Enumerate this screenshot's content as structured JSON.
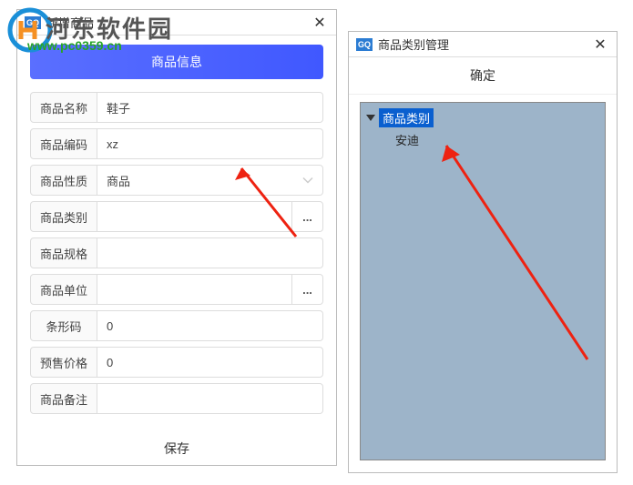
{
  "watermark": {
    "site_name": "河东软件园",
    "url": "www.pc0359.cn"
  },
  "left_window": {
    "app_icon": "GQ",
    "title": "新增商品",
    "section_title": "商品信息",
    "fields": {
      "name": {
        "label": "商品名称",
        "value": "鞋子"
      },
      "code": {
        "label": "商品编码",
        "value": "xz"
      },
      "nature": {
        "label": "商品性质",
        "value": "商品"
      },
      "category": {
        "label": "商品类别",
        "value": ""
      },
      "spec": {
        "label": "商品规格",
        "value": ""
      },
      "unit": {
        "label": "商品单位",
        "value": ""
      },
      "barcode": {
        "label": "条形码",
        "value": "0"
      },
      "presale": {
        "label": "预售价格",
        "value": "0"
      },
      "remark": {
        "label": "商品备注",
        "value": ""
      }
    },
    "ellipsis": "...",
    "save_label": "保存"
  },
  "right_window": {
    "app_icon": "GQ",
    "title": "商品类别管理",
    "confirm_label": "确定",
    "tree": {
      "root": "商品类别",
      "child": "安迪"
    }
  }
}
